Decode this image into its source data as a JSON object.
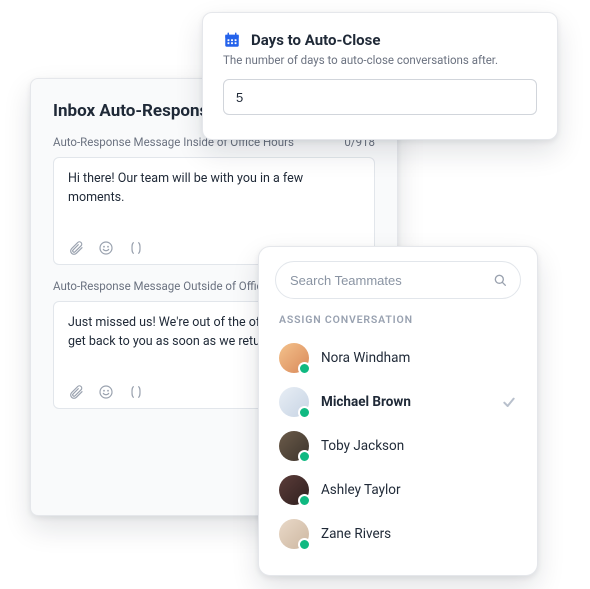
{
  "auto_close": {
    "title": "Days to Auto-Close",
    "description": "The number of days to auto-close conversations after.",
    "value": "5"
  },
  "auto_response": {
    "title": "Inbox Auto-Response",
    "inside": {
      "label": "Auto-Response Message Inside of Office Hours",
      "counter": "0/918",
      "message": "Hi there! Our team will be with you in a few moments."
    },
    "outside": {
      "label": "Auto-Response Message Outside of Office Hours",
      "message": "Just missed us! We're out of the office, but we will get back to you as soon as we return."
    }
  },
  "teammates": {
    "search_placeholder": "Search Teammates",
    "section_label": "ASSIGN CONVERSATION",
    "list": [
      {
        "name": "Nora Windham",
        "selected": false
      },
      {
        "name": "Michael Brown",
        "selected": true
      },
      {
        "name": "Toby Jackson",
        "selected": false
      },
      {
        "name": "Ashley Taylor",
        "selected": false
      },
      {
        "name": "Zane Rivers",
        "selected": false
      }
    ]
  }
}
